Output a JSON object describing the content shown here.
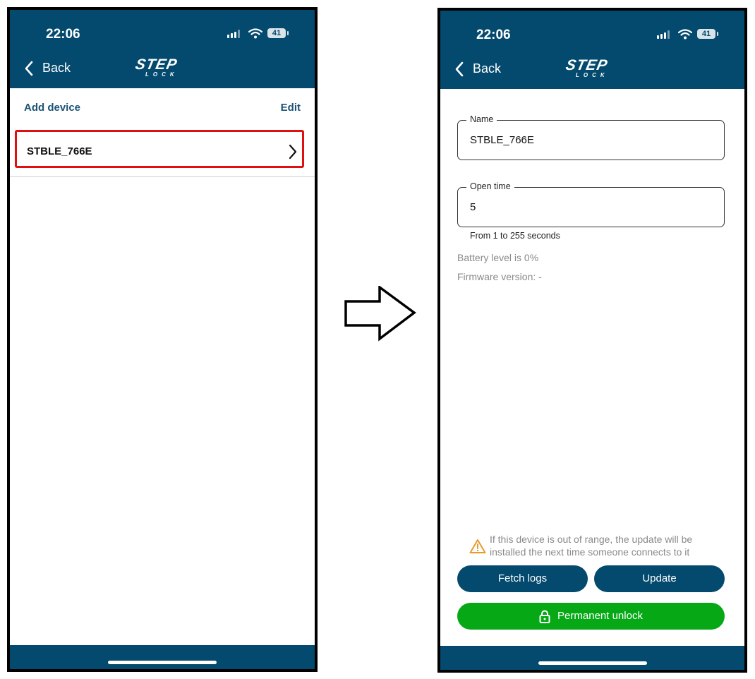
{
  "left_screen": {
    "status": {
      "time": "22:06",
      "battery": "41"
    },
    "header": {
      "back_label": "Back",
      "logo_main": "STEP",
      "logo_sub": "LOCK"
    },
    "toolbar": {
      "add_label": "Add device",
      "edit_label": "Edit"
    },
    "devices": [
      {
        "name": "STBLE_766E"
      }
    ]
  },
  "right_screen": {
    "status": {
      "time": "22:06",
      "battery": "41"
    },
    "header": {
      "back_label": "Back",
      "logo_main": "STEP",
      "logo_sub": "LOCK"
    },
    "name_field": {
      "label": "Name",
      "value": "STBLE_766E"
    },
    "open_time_field": {
      "label": "Open time",
      "value": "5",
      "helper": "From 1 to 255 seconds"
    },
    "battery_text": "Battery level is 0%",
    "firmware_text": "Firmware version: -",
    "warning_text": "If this device is out of range, the update will be installed the next time someone connects to it",
    "buttons": {
      "fetch_logs": "Fetch logs",
      "update": "Update",
      "permanent_unlock": "Permanent unlock"
    }
  },
  "colors": {
    "brand": "#034a6e",
    "highlight": "#e01010",
    "unlock": "#06a816",
    "warning": "#e89a2c"
  },
  "icons": [
    "back-chevron-icon",
    "signal-icon",
    "wifi-icon",
    "battery-icon",
    "chevron-right-icon",
    "warning-icon",
    "lock-icon",
    "right-arrow-icon"
  ]
}
